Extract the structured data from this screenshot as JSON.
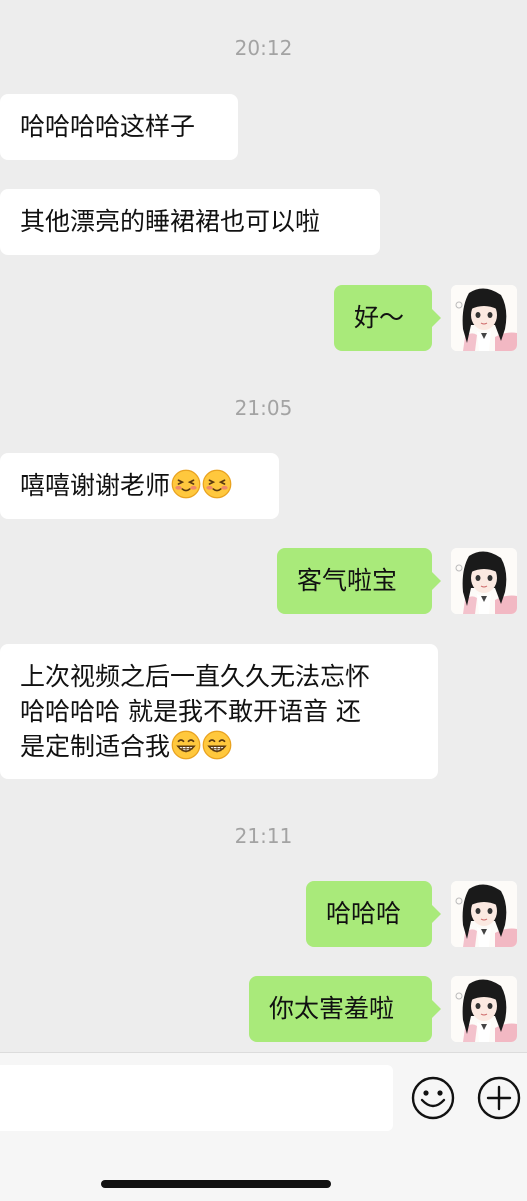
{
  "chat": {
    "messages": [
      {
        "type": "time",
        "text": "20:12"
      },
      {
        "type": "in",
        "text": "哈哈哈哈这样子"
      },
      {
        "type": "in",
        "text": "其他漂亮的睡裙裙也可以啦"
      },
      {
        "type": "out",
        "text": "好～"
      },
      {
        "type": "time",
        "text": "21:05"
      },
      {
        "type": "in",
        "text": "嘻嘻谢谢老师",
        "emoji": "blush-face-emoji x2"
      },
      {
        "type": "out",
        "text": "客气啦宝"
      },
      {
        "type": "in",
        "lines": [
          "上次视频之后一直久久无法忘怀",
          "哈哈哈哈 就是我不敢开语音 还",
          "是定制适合我"
        ],
        "emoji": "grin-face-emoji x2"
      },
      {
        "type": "time",
        "text": "21:11"
      },
      {
        "type": "out",
        "text": "哈哈哈"
      },
      {
        "type": "out",
        "text": "你太害羞啦"
      }
    ]
  },
  "toolbar": {
    "icons": [
      "emoji-icon",
      "plus-icon"
    ]
  },
  "colors": {
    "background": "#ededed",
    "incoming_bubble": "#ffffff",
    "outgoing_bubble": "#a9ea7a",
    "timestamp": "#a3a3a3"
  }
}
